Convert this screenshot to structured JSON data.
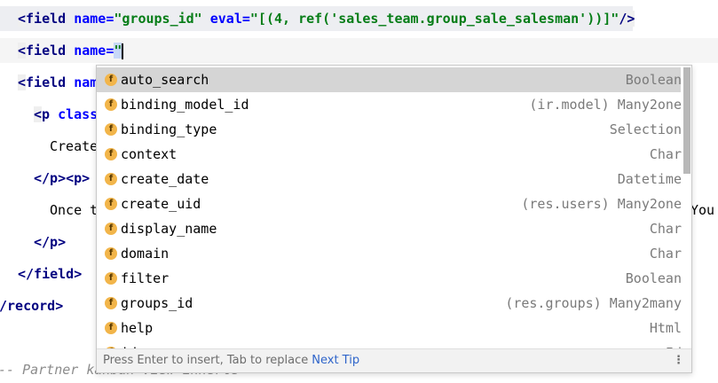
{
  "code": {
    "line1": {
      "open": "<",
      "tag": "field",
      "attr1": "name",
      "eq1": "=",
      "val1": "\"groups_id\"",
      "attr2": "eval",
      "eq2": "=",
      "val2": "\"[(4, ref('sales_team.group_sale_salesman'))]\"",
      "close": "/>"
    },
    "line2": {
      "open": "<",
      "tag": "field",
      "attr1": "name",
      "eq1": "=",
      "q": "\""
    },
    "line3": {
      "open": "<",
      "tag": "field",
      "attr_partial": "nam"
    },
    "line4": {
      "open": "<",
      "tag": "p",
      "attr_partial": "class"
    },
    "line5": {
      "text": "Create"
    },
    "line6": {
      "text": "</p><p>"
    },
    "line7": {
      "text": "Once t",
      "right_text": "You"
    },
    "line8": {
      "text": "</p>"
    },
    "line9": {
      "text": "</field>"
    },
    "line10": {
      "text": "/record>"
    },
    "line11": {
      "text": "-- Partner kanban view inherte -->"
    }
  },
  "completion": {
    "items": [
      {
        "name": "auto_search",
        "type": "Boolean",
        "icon": "f"
      },
      {
        "name": "binding_model_id",
        "type": "(ir.model) Many2one",
        "icon": "f"
      },
      {
        "name": "binding_type",
        "type": "Selection",
        "icon": "f"
      },
      {
        "name": "context",
        "type": "Char",
        "icon": "f"
      },
      {
        "name": "create_date",
        "type": "Datetime",
        "icon": "f"
      },
      {
        "name": "create_uid",
        "type": "(res.users) Many2one",
        "icon": "f"
      },
      {
        "name": "display_name",
        "type": "Char",
        "icon": "f"
      },
      {
        "name": "domain",
        "type": "Char",
        "icon": "f"
      },
      {
        "name": "filter",
        "type": "Boolean",
        "icon": "f"
      },
      {
        "name": "groups_id",
        "type": "(res.groups) Many2many",
        "icon": "f"
      },
      {
        "name": "help",
        "type": "Html",
        "icon": "f"
      },
      {
        "name": "id",
        "type": "Id",
        "icon": "f"
      }
    ],
    "footer_hint": "Press Enter to insert, Tab to replace",
    "footer_link": "Next Tip",
    "more_icon": "⋮"
  }
}
